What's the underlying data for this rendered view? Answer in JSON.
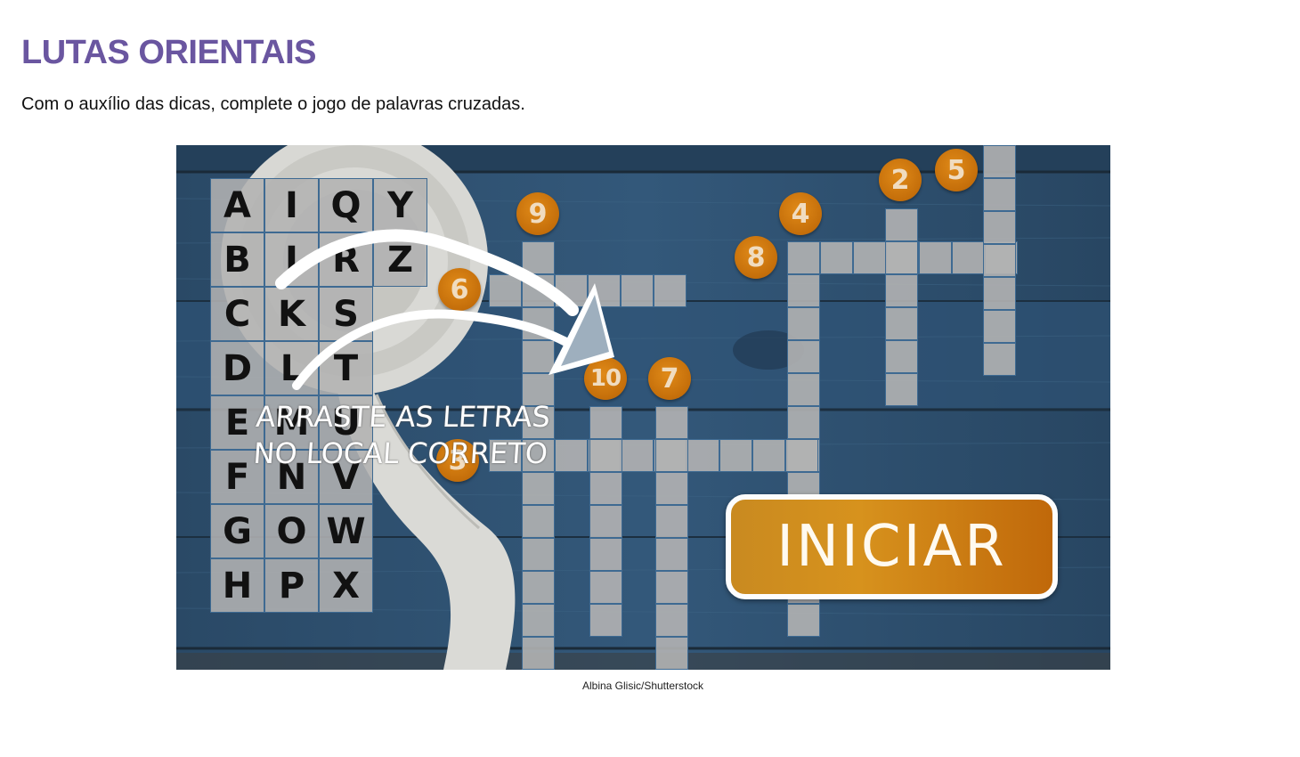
{
  "page": {
    "title": "LUTAS ORIENTAIS",
    "instruction": "Com o auxílio das dicas, complete o jogo de palavras cruzadas.",
    "image_credit": "Albina Glisic/Shutterstock"
  },
  "game": {
    "letter_bank": [
      [
        "A",
        "I",
        "Q",
        "Y"
      ],
      [
        "B",
        "J",
        "R",
        "Z"
      ],
      [
        "C",
        "K",
        "S",
        ""
      ],
      [
        "D",
        "L",
        "T",
        ""
      ],
      [
        "E",
        "M",
        "U",
        ""
      ],
      [
        "F",
        "N",
        "V",
        ""
      ],
      [
        "G",
        "O",
        "W",
        ""
      ],
      [
        "H",
        "P",
        "X",
        ""
      ]
    ],
    "clue_numbers": [
      "2",
      "5",
      "9",
      "4",
      "8",
      "6",
      "10",
      "7",
      "3"
    ],
    "drag_hint_line1": "ARRASTE AS LETRAS",
    "drag_hint_line2": "NO LOCAL CORRETO",
    "start_button_label": "INICIAR",
    "colors": {
      "wood_blue": "#2d4d6b",
      "badge_orange": "#c46e0a",
      "button_orange": "#d7921d",
      "title_purple": "#6a56a0"
    }
  }
}
